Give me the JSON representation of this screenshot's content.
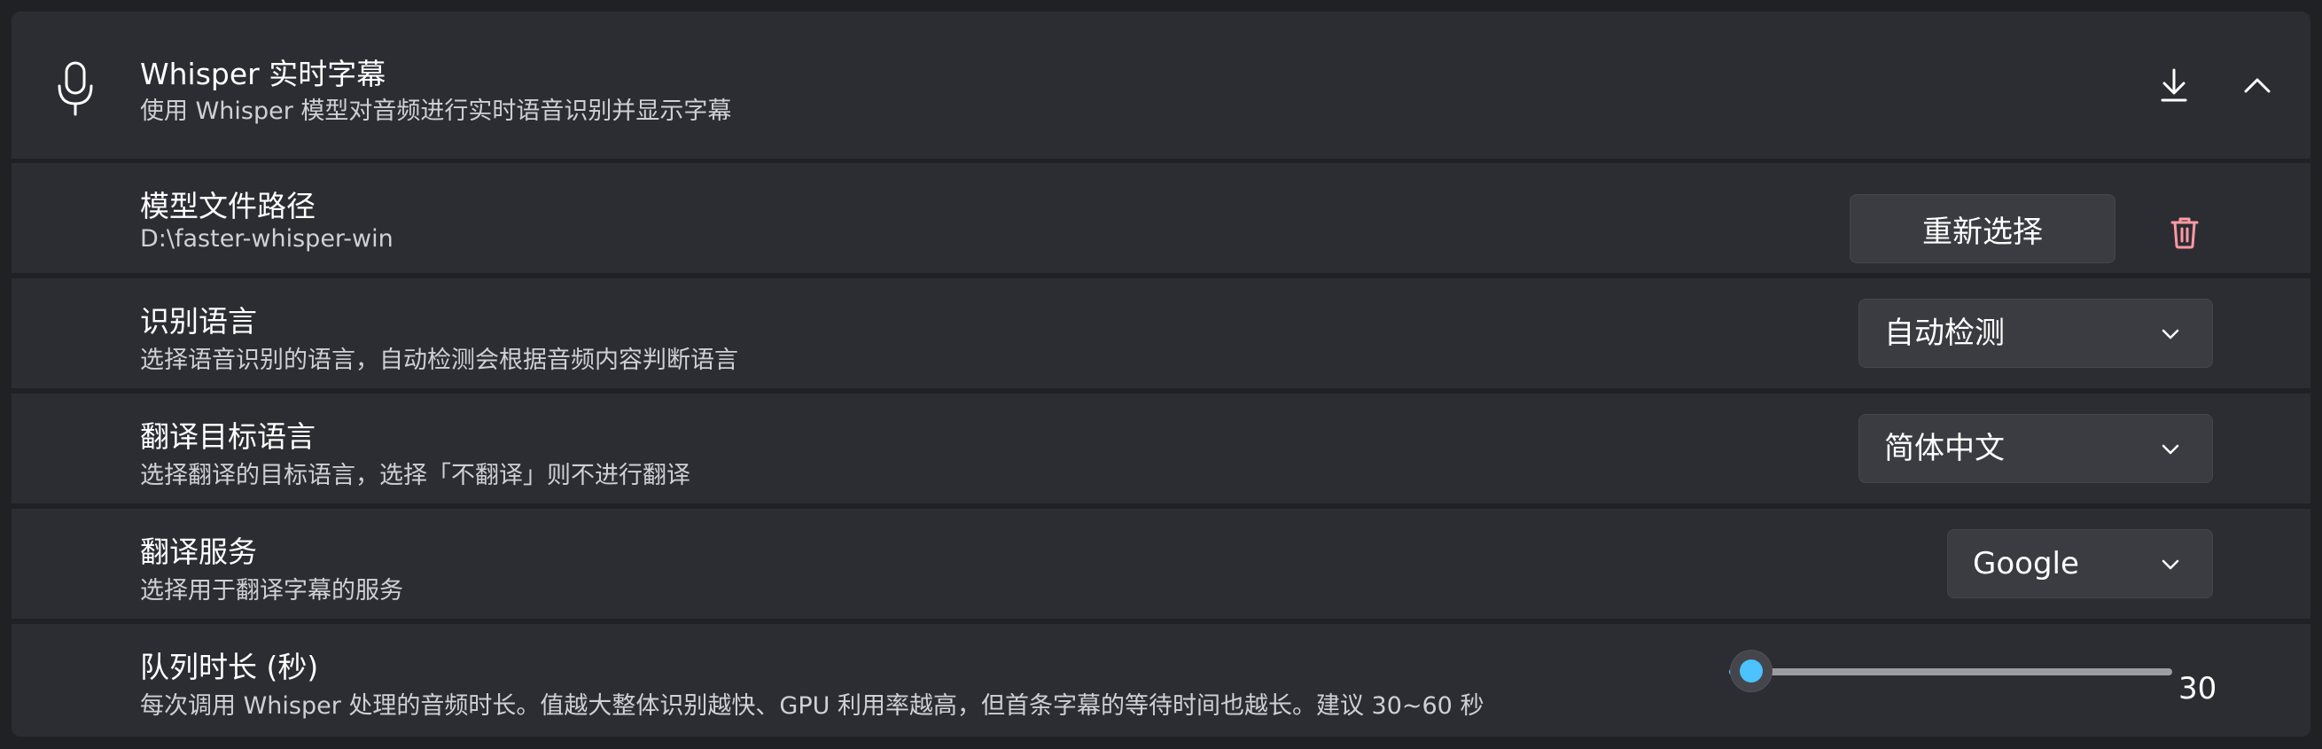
{
  "header": {
    "title": "Whisper 实时字幕",
    "description": "使用 Whisper 模型对音频进行实时语音识别并显示字幕",
    "expanded": true
  },
  "model_path": {
    "title": "模型文件路径",
    "value": "D:\\faster-whisper-win",
    "reselect_label": "重新选择"
  },
  "recognition_language": {
    "title": "识别语言",
    "description": "选择语音识别的语言，自动检测会根据音频内容判断语言",
    "selected": "自动检测"
  },
  "target_language": {
    "title": "翻译目标语言",
    "description": "选择翻译的目标语言，选择「不翻译」则不进行翻译",
    "selected": "简体中文"
  },
  "translation_service": {
    "title": "翻译服务",
    "description": "选择用于翻译字幕的服务",
    "selected": "Google"
  },
  "queue_duration": {
    "title": "队列时长 (秒)",
    "description": "每次调用 Whisper 处理的音频时长。值越大整体识别越快、GPU 利用率越高，但首条字幕的等待时间也越长。建议 30~60 秒",
    "value": "30",
    "slider_fraction": 0.05
  },
  "colors": {
    "accent": "#4cc2ff",
    "delete": "#ff99a4",
    "card": "#2c2d33",
    "background": "#202125"
  },
  "icons": {
    "header": "microphone-icon",
    "download": "download-icon",
    "collapse": "chevron-up-icon",
    "delete": "trash-icon",
    "dropdown": "chevron-down-icon"
  }
}
